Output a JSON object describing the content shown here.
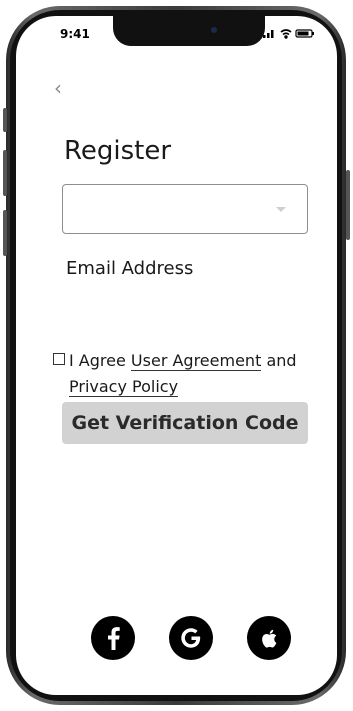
{
  "status_bar": {
    "time": "9:41",
    "icons": [
      "signal-icon",
      "wifi-icon",
      "battery-icon"
    ]
  },
  "nav": {
    "back_icon": "chevron-left-icon",
    "back_glyph": "‹"
  },
  "page": {
    "title": "Register"
  },
  "form": {
    "select_value": "",
    "field_label": "Email Address",
    "agree_prefix": "I Agree",
    "user_agreement_link": "User Agreement",
    "agree_middle": "and",
    "privacy_policy_link": "Privacy Policy",
    "checkbox_checked": false,
    "submit_label": "Get Verification Code"
  },
  "social": {
    "items": [
      {
        "name": "facebook-icon",
        "glyph": "f"
      },
      {
        "name": "google-icon",
        "glyph": "G"
      },
      {
        "name": "apple-icon",
        "glyph": ""
      }
    ]
  },
  "colors": {
    "button_bg": "#d2d2d2",
    "text": "#1a1a1a",
    "social_bg": "#000000"
  }
}
